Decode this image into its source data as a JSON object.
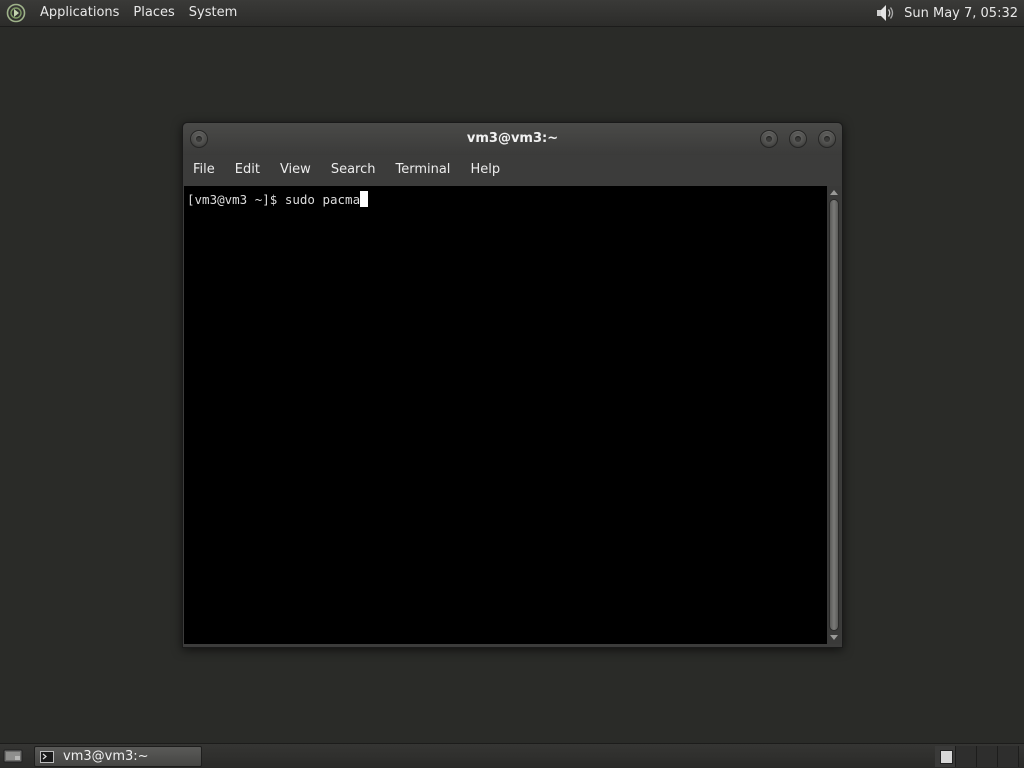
{
  "top_panel": {
    "menus": [
      "Applications",
      "Places",
      "System"
    ],
    "clock": "Sun May  7, 05:32",
    "icons": {
      "menu_logo": "distro-logo-icon",
      "volume": "speaker-volume-icon"
    }
  },
  "window": {
    "title": "vm3@vm3:~",
    "menu": [
      "File",
      "Edit",
      "View",
      "Search",
      "Terminal",
      "Help"
    ],
    "terminal": {
      "prompt": "[vm3@vm3 ~]$ ",
      "input": "sudo pacma",
      "background": "#000000",
      "foreground": "#dcdcdc"
    }
  },
  "taskbar": {
    "task_label": "vm3@vm3:~",
    "workspaces": 4,
    "active_workspace": 1
  },
  "colors": {
    "desktop": "#2a2b28",
    "panel": "#2c2c2a",
    "window_chrome": "#3c3c3b"
  }
}
